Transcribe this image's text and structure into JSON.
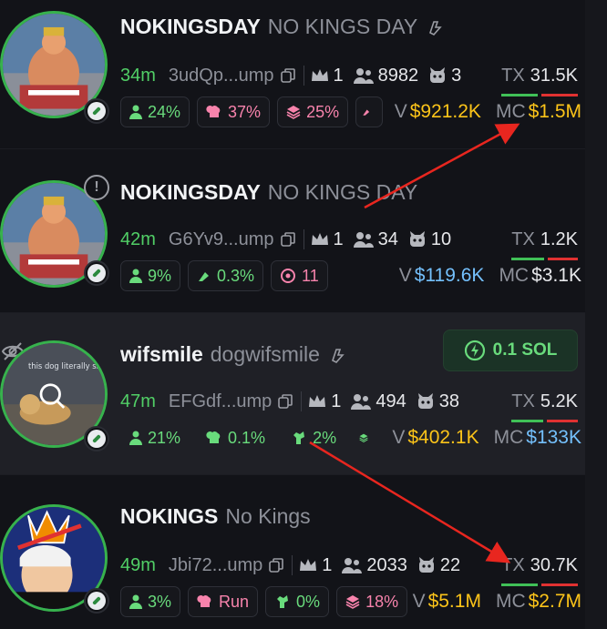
{
  "tokens": [
    {
      "ticker": "NOKINGSDAY",
      "name": "NO KINGS DAY",
      "age": "34m",
      "address": "3udQp...ump",
      "crown_count": "1",
      "holders": "8982",
      "bots": "3",
      "tx_label": "TX",
      "tx": "31.5K",
      "chips": [
        {
          "icon": "user-icon",
          "value": "24%",
          "color": "#69db7c"
        },
        {
          "icon": "chef-hat-icon",
          "value": "37%",
          "color": "#f783ac"
        },
        {
          "icon": "layers-icon",
          "value": "25%",
          "color": "#f783ac"
        }
      ],
      "v_label": "V",
      "volume": "$921.2K",
      "mc_label": "MC",
      "market_cap": "$1.5M"
    },
    {
      "ticker": "NOKINGSDAY",
      "name": "NO KINGS DAY",
      "age": "42m",
      "address": "G6Yv9...ump",
      "crown_count": "1",
      "holders": "34",
      "bots": "10",
      "tx_label": "TX",
      "tx": "1.2K",
      "chips": [
        {
          "icon": "user-icon",
          "value": "9%",
          "color": "#69db7c"
        },
        {
          "icon": "gas-icon",
          "value": "0.3%",
          "color": "#69db7c"
        },
        {
          "icon": "target-icon",
          "value": "11",
          "color": "#f783ac"
        }
      ],
      "v_label": "V",
      "volume": "$119.6K",
      "mc_label": "MC",
      "market_cap": "$3.1K"
    },
    {
      "ticker": "wifsmile",
      "name": "dogwifsmile",
      "age": "47m",
      "address": "EFGdf...ump",
      "crown_count": "1",
      "holders": "494",
      "bots": "38",
      "tx_label": "TX",
      "tx": "5.2K",
      "buy_label": "0.1 SOL",
      "chips": [
        {
          "icon": "user-icon",
          "value": "21%",
          "color": "#69db7c"
        },
        {
          "icon": "chef-hat-icon",
          "value": "0.1%",
          "color": "#69db7c"
        },
        {
          "icon": "sniper-icon",
          "value": "2%",
          "color": "#69db7c"
        }
      ],
      "v_label": "V",
      "volume": "$402.1K",
      "mc_label": "MC",
      "market_cap": "$133K",
      "image_caption": "this dog literally smiled at me"
    },
    {
      "ticker": "NOKINGS",
      "name": "No Kings",
      "age": "49m",
      "address": "Jbi72...ump",
      "crown_count": "1",
      "holders": "2033",
      "bots": "22",
      "tx_label": "TX",
      "tx": "30.7K",
      "chips": [
        {
          "icon": "user-icon",
          "value": "3%",
          "color": "#69db7c"
        },
        {
          "icon": "chef-hat-icon",
          "value": "Run",
          "color": "#f783ac"
        },
        {
          "icon": "sniper-icon",
          "value": "0%",
          "color": "#69db7c"
        },
        {
          "icon": "layers-icon",
          "value": "18%",
          "color": "#f783ac"
        }
      ],
      "v_label": "V",
      "volume": "$5.1M",
      "mc_label": "MC",
      "market_cap": "$2.7M"
    }
  ],
  "colors": {
    "accent_green": "#51cf66",
    "gold": "#fcc419",
    "blue": "#74c0fc",
    "pink": "#f783ac",
    "arrow_red": "#e8261f"
  }
}
